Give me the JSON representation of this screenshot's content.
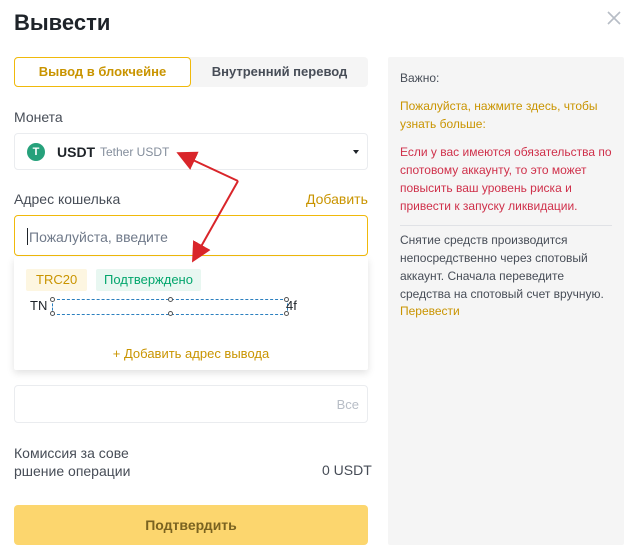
{
  "dialog": {
    "title": "Вывести"
  },
  "tabs": [
    {
      "label": "Вывод в блокчейне",
      "active": true
    },
    {
      "label": "Внутренний перевод",
      "active": false
    }
  ],
  "coin": {
    "label": "Монета",
    "code": "USDT",
    "name": "Tether USDT",
    "icon_glyph": "T"
  },
  "wallet": {
    "label": "Адрес кошелька",
    "add_label": "Добавить",
    "placeholder": "Пожалуйста, введите"
  },
  "saved_address": {
    "network": "TRC20",
    "status": "Подтверждено",
    "address_start": "TN",
    "address_end": "4f",
    "add_new_label": "+ Добавить адрес вывода"
  },
  "amount": {
    "max_label": "Все"
  },
  "fee": {
    "label": "Комиссия за совершение операции",
    "label_line1": "Комиссия за сове",
    "label_line2": "ршение операции",
    "value": "0 USDT"
  },
  "confirm_label": "Подтвердить",
  "side_panel": {
    "heading": "Важно:",
    "info_link": "Пожалуйста, нажмите здесь, чтобы узнать больше:",
    "warning": "Если у вас имеются обязательства по спотовому аккаунту, то это может повысить ваш уровень риска и привести к запуску ликвидации.",
    "note": "Снятие средств производится непосредственно через спотовый аккаунт. Сначала переведите средства на спотовый счет вручную.",
    "transfer_link": "Перевести"
  },
  "colors": {
    "accent": "#f0b90b",
    "accent_text": "#c99400",
    "success": "#03a66d",
    "danger": "#cf304a",
    "annotation_arrow": "#d9252a",
    "tether": "#26a17b"
  }
}
